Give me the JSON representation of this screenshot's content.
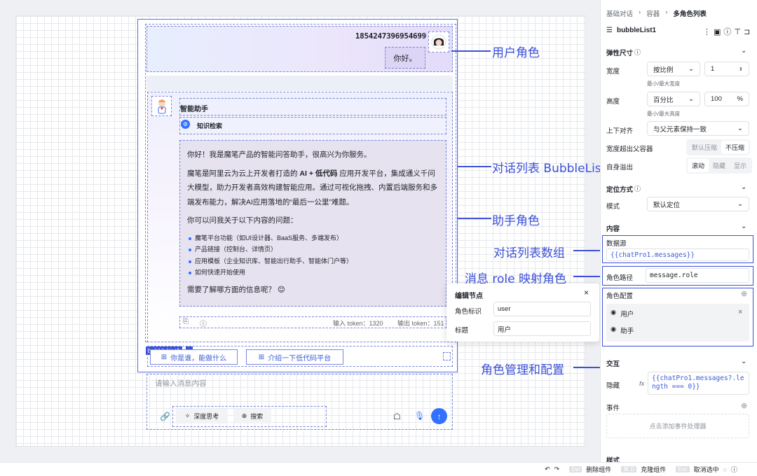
{
  "canvas": {
    "user": {
      "name": "1854247396954699",
      "message": "你好。"
    },
    "assistant": {
      "name": "智能助手",
      "knowledge": "知识检索",
      "p1": "你好！我是魔笔产品的智能问答助手，很高兴为你服务。",
      "p2_a": "魔笔是阿里云为云上开发者打造的 ",
      "p2_b": "AI + 低代码",
      "p2_c": " 应用开发平台，集成通义千问大模型，助力开发者高效构建智能应用。通过可视化拖拽、内置后端服务和多端发布能力，解决AI应用落地的“最后一公里”难题。",
      "p3": "你可以问我关于以下内容的问题：",
      "list": [
        "魔笔平台功能（如UI设计器、BaaS服务、多端发布）",
        "产品链接（控制台、详情页）",
        "应用模板（企业知识库、智能出行助手、智能体门户等）",
        "如何快速开始使用"
      ],
      "p4": "需要了解哪方面的信息呢？ 😊",
      "token_in": "输入 token：1320",
      "token_out": "输出 token：151"
    },
    "tag": "bubbleList1",
    "suggestions": [
      "你是谁，能做什么",
      "介绍一下低代码平台"
    ],
    "input_placeholder": "请输入消息内容",
    "tools": [
      "深度思考",
      "搜索"
    ]
  },
  "annotations": {
    "user_role": "用户角色",
    "bubblelist": "对话列表 BubbleList",
    "assistant_role": "助手角色",
    "data_array": "对话列表数组",
    "role_map": "消息 role 映射角色",
    "role_mgmt": "角色管理和配置"
  },
  "popup": {
    "title": "编辑节点",
    "label1": "角色标识",
    "value1": "user",
    "label2": "标题",
    "value2": "用户"
  },
  "panel": {
    "breadcrumb": [
      "基础对话",
      "容器",
      "多角色列表"
    ],
    "component": "bubbleList1",
    "flex_size": "弹性尺寸",
    "width_label": "宽度",
    "width_mode": "按比例",
    "width_value": "1",
    "min_max_w": "最小/最大宽度",
    "height_label": "高度",
    "height_mode": "百分比",
    "height_value": "100",
    "height_unit": "%",
    "min_max_h": "最小/最大高度",
    "align_label": "上下对齐",
    "align_value": "与父元素保持一致",
    "width_overflow": "宽度超出父容器",
    "wo_opts": [
      "默认压缩",
      "不压缩"
    ],
    "self_overflow": "自身溢出",
    "so_opts": [
      "滚动",
      "隐藏",
      "显示"
    ],
    "position": "定位方式",
    "mode_label": "模式",
    "mode_value": "默认定位",
    "content": "内容",
    "datasource": "数据源",
    "datasource_value": "{{chatPro1.messages}}",
    "role_path": "角色路径",
    "role_path_value": "message.role",
    "role_config": "角色配置",
    "roles": [
      "用户",
      "助手"
    ],
    "interaction": "交互",
    "hidden": "隐藏",
    "hidden_value": "{{chatPro1.messages?.length === 0}}",
    "events": "事件",
    "add_event": "点击添加事件处理器",
    "style": "样式"
  },
  "bottom": {
    "delete": "删除组件",
    "clone": "克隆组件",
    "cancel": "取消选中",
    "del_key": "Del",
    "clone_key": "⌘ D",
    "esc_key": "Esc"
  }
}
